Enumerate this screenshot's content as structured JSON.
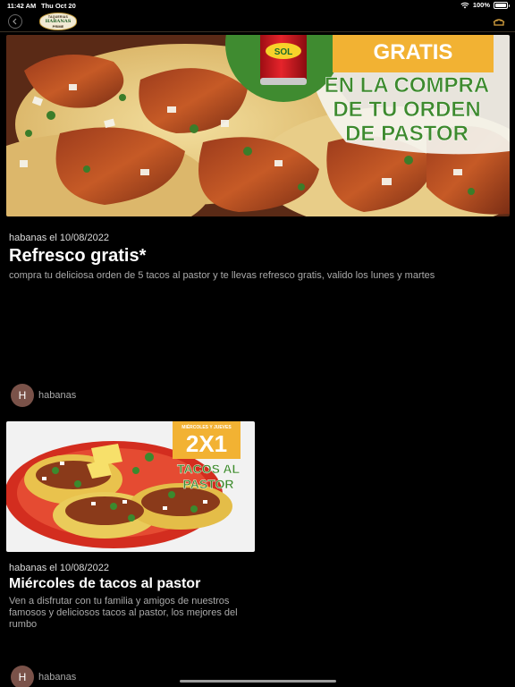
{
  "status_bar": {
    "time": "11:42 AM",
    "date": "Thu Oct 20",
    "battery": "100%"
  },
  "nav": {
    "logo_line1": "TAQUERIAS",
    "logo_line2": "HABANAS",
    "logo_line3": "PRIME",
    "icons": [
      "back-arrow-icon",
      "cart-icon"
    ]
  },
  "posts": [
    {
      "meta": "habanas el 10/08/2022",
      "title": "Refresco gratis*",
      "description": "compra tu deliciosa orden de 5 tacos al pastor y te llevas refresco gratis, valido los lunes y martes",
      "author_initial": "H",
      "author": "habanas",
      "banner": {
        "can_label": "SOL",
        "badge": "GRATIS",
        "headline_1": "EN LA COMPRA",
        "headline_2": "DE TU ORDEN",
        "headline_3": "DE PASTOR"
      }
    },
    {
      "meta": "habanas el 10/08/2022",
      "title": "Miércoles de tacos al pastor",
      "description": "Ven a disfrutar con tu familia y amigos de nuestros famosos y deliciosos tacos al pastor, los mejores del rumbo",
      "author_initial": "H",
      "author": "habanas",
      "banner": {
        "days": "MIÉRCOLES Y JUEVES",
        "promo": "2X1",
        "line_1": "TACOS AL",
        "line_2": "PASTOR"
      }
    }
  ],
  "colors": {
    "accent_gold": "#f2b233",
    "green_text": "#3e8a2e",
    "avatar_bg": "#7a5249"
  }
}
